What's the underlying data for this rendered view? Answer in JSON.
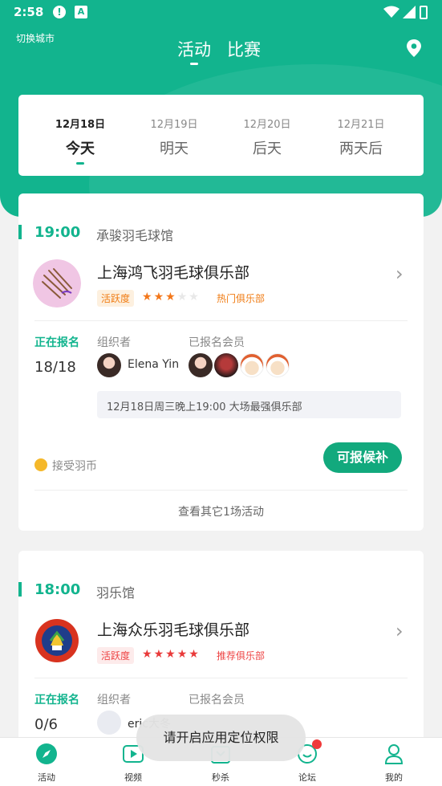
{
  "status_bar": {
    "time": "2:58"
  },
  "header": {
    "city_switch": "切换城市",
    "tabs": [
      {
        "label": "活动",
        "active": true
      },
      {
        "label": "比赛",
        "active": false
      }
    ],
    "location_icon": "location-pin-icon"
  },
  "date_tabs": [
    {
      "date": "12月18日",
      "weekday": "今天",
      "active": true
    },
    {
      "date": "12月19日",
      "weekday": "明天",
      "active": false
    },
    {
      "date": "12月20日",
      "weekday": "后天",
      "active": false
    },
    {
      "date": "12月21日",
      "weekday": "两天后",
      "active": false
    }
  ],
  "events": [
    {
      "time": "19:00",
      "venue": "承骏羽毛球馆",
      "club_name": "上海鸿飞羽毛球俱乐部",
      "activity_label": "活跃度",
      "rating": 3,
      "rating_max": 5,
      "club_type": "热门俱乐部",
      "status": "正在报名",
      "count": "18/18",
      "organizer_label": "组织者",
      "organizer_name": "Elena Yin",
      "members_label": "已报名会员",
      "description": "12月18日周三晚上19:00 大场最强俱乐部",
      "coin_text": "接受羽币",
      "action_button": "可报候补",
      "more_link": "查看其它1场活动"
    },
    {
      "time": "18:00",
      "venue": "羽乐馆",
      "club_name": "上海众乐羽毛球俱乐部",
      "activity_label": "活跃度",
      "rating": 5,
      "rating_max": 5,
      "club_type": "推荐俱乐部",
      "status": "正在报名",
      "count": "0/6",
      "organizer_label": "组织者",
      "organizer_name": "eric大冬",
      "members_label": "已报名会员"
    }
  ],
  "tabbar": [
    {
      "label": "活动",
      "icon": "compass-icon",
      "active": true
    },
    {
      "label": "视频",
      "icon": "video-play-icon",
      "active": false
    },
    {
      "label": "秒杀",
      "icon": "flash-sale-icon",
      "active": false
    },
    {
      "label": "论坛",
      "icon": "chat-bubble-icon",
      "active": false,
      "badge": true
    },
    {
      "label": "我的",
      "icon": "user-icon",
      "active": false
    }
  ],
  "toast": "请开启应用定位权限",
  "colors": {
    "primary": "#12b48e",
    "star_orange": "#f3771a",
    "star_red": "#e93a3a",
    "badge_red": "#f03a3a"
  }
}
